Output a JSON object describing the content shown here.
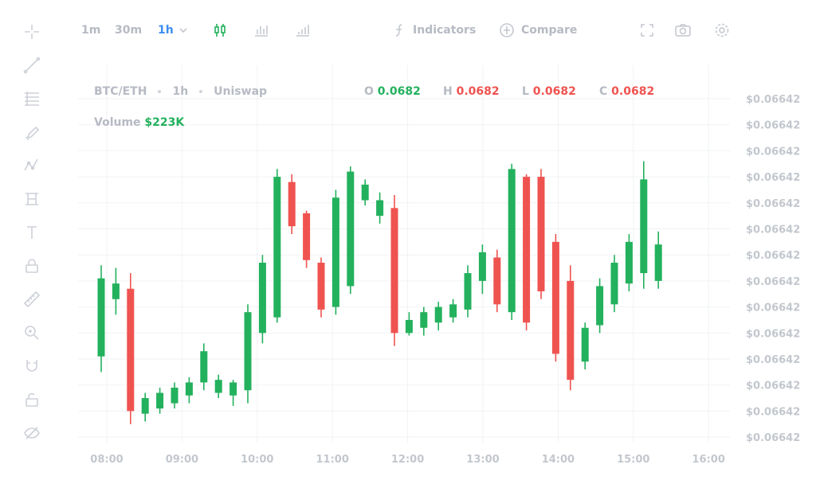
{
  "toolbar": {
    "intervals": [
      "1m",
      "30m",
      "1h"
    ],
    "active_interval": "1h",
    "indicators_label": "Indicators",
    "compare_label": "Compare",
    "icons": [
      "candles-icon",
      "bars-icon",
      "columns-icon",
      "function-icon",
      "compare-icon",
      "fullscreen-icon",
      "camera-icon",
      "settings-icon"
    ]
  },
  "sidebar": {
    "tools": [
      "crosshair-icon",
      "trendline-icon",
      "fib-icon",
      "brush-icon",
      "pattern-icon",
      "projection-icon",
      "text-icon",
      "lock-icon",
      "ruler-icon",
      "zoom-icon",
      "magnet-icon",
      "unlock-icon",
      "visibility-icon"
    ]
  },
  "legend": {
    "pair": "BTC/ETH",
    "interval": "1h",
    "exchange": "Uniswap",
    "o_label": "O",
    "o_value": "0.0682",
    "h_label": "H",
    "h_value": "0.0682",
    "l_label": "L",
    "l_value": "0.0682",
    "c_label": "C",
    "c_value": "0.0682",
    "volume_label": "Volume",
    "volume_value": "$223K"
  },
  "colors": {
    "up": "#23b15d",
    "down": "#ef5350",
    "grid": "#f1f2f5",
    "axis_text": "#c3c7ce"
  },
  "chart_data": {
    "type": "candlestick",
    "x_ticks": [
      "08:00",
      "09:00",
      "10:00",
      "11:00",
      "12:00",
      "13:00",
      "14:00",
      "15:00",
      "16:00"
    ],
    "y_tick_labels": [
      "$0.06642",
      "$0.06642",
      "$0.06642",
      "$0.06642",
      "$0.06642",
      "$0.06642",
      "$0.06642",
      "$0.06642",
      "$0.06642",
      "$0.06642",
      "$0.06642",
      "$0.06642",
      "$0.06642",
      "$0.06642"
    ],
    "ylim": [
      0,
      14
    ],
    "grid": true,
    "candles": [
      {
        "time": "08:00",
        "open": 3.1,
        "high": 6.6,
        "low": 2.5,
        "close": 6.1
      },
      {
        "time": "08:12",
        "open": 5.3,
        "high": 6.5,
        "low": 4.7,
        "close": 5.9
      },
      {
        "time": "08:24",
        "open": 5.7,
        "high": 6.3,
        "low": 0.5,
        "close": 1.0
      },
      {
        "time": "08:36",
        "open": 0.9,
        "high": 1.7,
        "low": 0.6,
        "close": 1.5
      },
      {
        "time": "08:48",
        "open": 1.1,
        "high": 1.9,
        "low": 0.9,
        "close": 1.7
      },
      {
        "time": "09:00",
        "open": 1.3,
        "high": 2.1,
        "low": 1.1,
        "close": 1.9
      },
      {
        "time": "09:12",
        "open": 1.6,
        "high": 2.3,
        "low": 1.3,
        "close": 2.1
      },
      {
        "time": "09:24",
        "open": 2.1,
        "high": 3.6,
        "low": 1.8,
        "close": 3.3
      },
      {
        "time": "09:36",
        "open": 1.7,
        "high": 2.4,
        "low": 1.5,
        "close": 2.2
      },
      {
        "time": "09:48",
        "open": 1.6,
        "high": 2.2,
        "low": 1.2,
        "close": 2.1
      },
      {
        "time": "10:00",
        "open": 1.8,
        "high": 5.1,
        "low": 1.3,
        "close": 4.8
      },
      {
        "time": "10:12",
        "open": 4.0,
        "high": 7.0,
        "low": 3.6,
        "close": 6.7
      },
      {
        "time": "10:24",
        "open": 4.6,
        "high": 10.3,
        "low": 4.4,
        "close": 10.0
      },
      {
        "time": "10:36",
        "open": 9.8,
        "high": 10.1,
        "low": 7.8,
        "close": 8.1
      },
      {
        "time": "10:48",
        "open": 8.6,
        "high": 8.7,
        "low": 6.5,
        "close": 6.8
      },
      {
        "time": "11:00",
        "open": 6.7,
        "high": 6.9,
        "low": 4.6,
        "close": 4.9
      },
      {
        "time": "11:12",
        "open": 5.0,
        "high": 9.5,
        "low": 4.7,
        "close": 9.2
      },
      {
        "time": "11:24",
        "open": 5.8,
        "high": 10.4,
        "low": 5.5,
        "close": 10.2
      },
      {
        "time": "11:36",
        "open": 9.1,
        "high": 9.9,
        "low": 8.9,
        "close": 9.7
      },
      {
        "time": "11:48",
        "open": 8.5,
        "high": 9.4,
        "low": 8.2,
        "close": 9.1
      },
      {
        "time": "12:00",
        "open": 8.8,
        "high": 9.3,
        "low": 3.5,
        "close": 4.0
      },
      {
        "time": "12:12",
        "open": 4.0,
        "high": 4.8,
        "low": 3.9,
        "close": 4.5
      },
      {
        "time": "12:24",
        "open": 4.2,
        "high": 5.0,
        "low": 3.9,
        "close": 4.8
      },
      {
        "time": "12:36",
        "open": 4.4,
        "high": 5.2,
        "low": 4.1,
        "close": 5.0
      },
      {
        "time": "12:48",
        "open": 4.6,
        "high": 5.3,
        "low": 4.4,
        "close": 5.1
      },
      {
        "time": "13:00",
        "open": 4.9,
        "high": 6.6,
        "low": 4.6,
        "close": 6.3
      },
      {
        "time": "13:12",
        "open": 6.0,
        "high": 7.4,
        "low": 5.5,
        "close": 7.1
      },
      {
        "time": "13:24",
        "open": 6.9,
        "high": 7.2,
        "low": 4.8,
        "close": 5.1
      },
      {
        "time": "13:36",
        "open": 4.8,
        "high": 10.5,
        "low": 4.5,
        "close": 10.3
      },
      {
        "time": "13:48",
        "open": 10.0,
        "high": 10.1,
        "low": 4.1,
        "close": 4.4
      },
      {
        "time": "14:00",
        "open": 10.0,
        "high": 10.3,
        "low": 5.3,
        "close": 5.6
      },
      {
        "time": "14:12",
        "open": 7.5,
        "high": 7.8,
        "low": 2.9,
        "close": 3.2
      },
      {
        "time": "14:24",
        "open": 6.0,
        "high": 6.6,
        "low": 1.8,
        "close": 2.2
      },
      {
        "time": "14:36",
        "open": 2.9,
        "high": 4.4,
        "low": 2.6,
        "close": 4.2
      },
      {
        "time": "14:48",
        "open": 4.3,
        "high": 6.1,
        "low": 4.0,
        "close": 5.8
      },
      {
        "time": "15:00",
        "open": 5.1,
        "high": 7.0,
        "low": 4.8,
        "close": 6.7
      },
      {
        "time": "15:12",
        "open": 5.9,
        "high": 7.8,
        "low": 5.6,
        "close": 7.5
      },
      {
        "time": "15:24",
        "open": 6.3,
        "high": 10.6,
        "low": 5.7,
        "close": 9.9
      },
      {
        "time": "15:36",
        "open": 6.0,
        "high": 7.9,
        "low": 5.7,
        "close": 7.4
      }
    ]
  }
}
